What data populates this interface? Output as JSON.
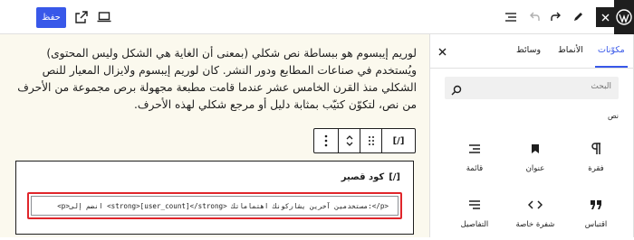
{
  "toolbar": {
    "save_label": "حفظ",
    "icons": [
      "view-external-icon",
      "device-preview-icon",
      "document-overview-icon",
      "undo-icon",
      "redo-icon",
      "tools-pencil-icon",
      "close-inserter-icon",
      "wordpress-logo-icon"
    ]
  },
  "canvas": {
    "paragraph": "لوريم إيبسوم هو ببساطة نص شكلي (بمعنى أن الغاية هي الشكل وليس المحتوى) ويُستخدم في صناعات المطابع ودور النشر. كان لوريم إيبسوم ولايزال المعيار للنص الشكلي منذ القرن الخامس عشر عندما قامت مطبعة مجهولة برص مجموعة من الأحرف من نص، لتكوّن كتيّب بمثابة دليل أو مرجع شكلي لهذه الأحرف.",
    "block_toolbar": {
      "shortcode_icon_text": "[/]"
    },
    "shortcode_block": {
      "label": "كود قصير",
      "icon_text": "[/]",
      "value": "<p>انضم إلى <strong>[user_count]</strong> مستخدمين آخرين يشاركونك اهتماماتك:</p>"
    }
  },
  "sidebar": {
    "tabs": [
      {
        "label": "مكوّنات",
        "active": true
      },
      {
        "label": "الأنماط",
        "active": false
      },
      {
        "label": "وسائط",
        "active": false
      }
    ],
    "search_placeholder": "البحث",
    "category_title": "نص",
    "blocks": [
      {
        "label": "فقرة",
        "icon": "paragraph-icon"
      },
      {
        "label": "عنوان",
        "icon": "heading-bookmark-icon"
      },
      {
        "label": "قائمة",
        "icon": "list-icon"
      },
      {
        "label": "اقتباس",
        "icon": "quote-icon"
      },
      {
        "label": "شفرة خاصة",
        "icon": "code-icon"
      },
      {
        "label": "التفاصيل",
        "icon": "details-icon"
      }
    ]
  },
  "colors": {
    "accent": "#3858e9",
    "canvas_bg": "#fbf9ee",
    "highlight": "#e0262b",
    "dark": "#1e1e1e"
  }
}
